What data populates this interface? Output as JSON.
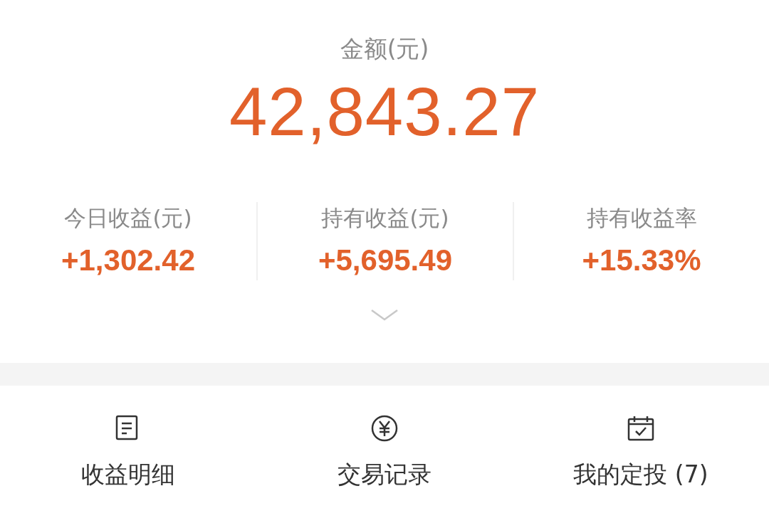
{
  "balance": {
    "label": "金额(元)",
    "value": "42,843.27"
  },
  "stats": [
    {
      "label": "今日收益(元)",
      "value": "+1,302.42"
    },
    {
      "label": "持有收益(元)",
      "value": "+5,695.49"
    },
    {
      "label": "持有收益率",
      "value": "+15.33%"
    }
  ],
  "actions": [
    {
      "kind": "document",
      "label": "收益明细"
    },
    {
      "kind": "yen",
      "label": "交易记录"
    },
    {
      "kind": "calendar",
      "label": "我的定投 (7)"
    }
  ]
}
